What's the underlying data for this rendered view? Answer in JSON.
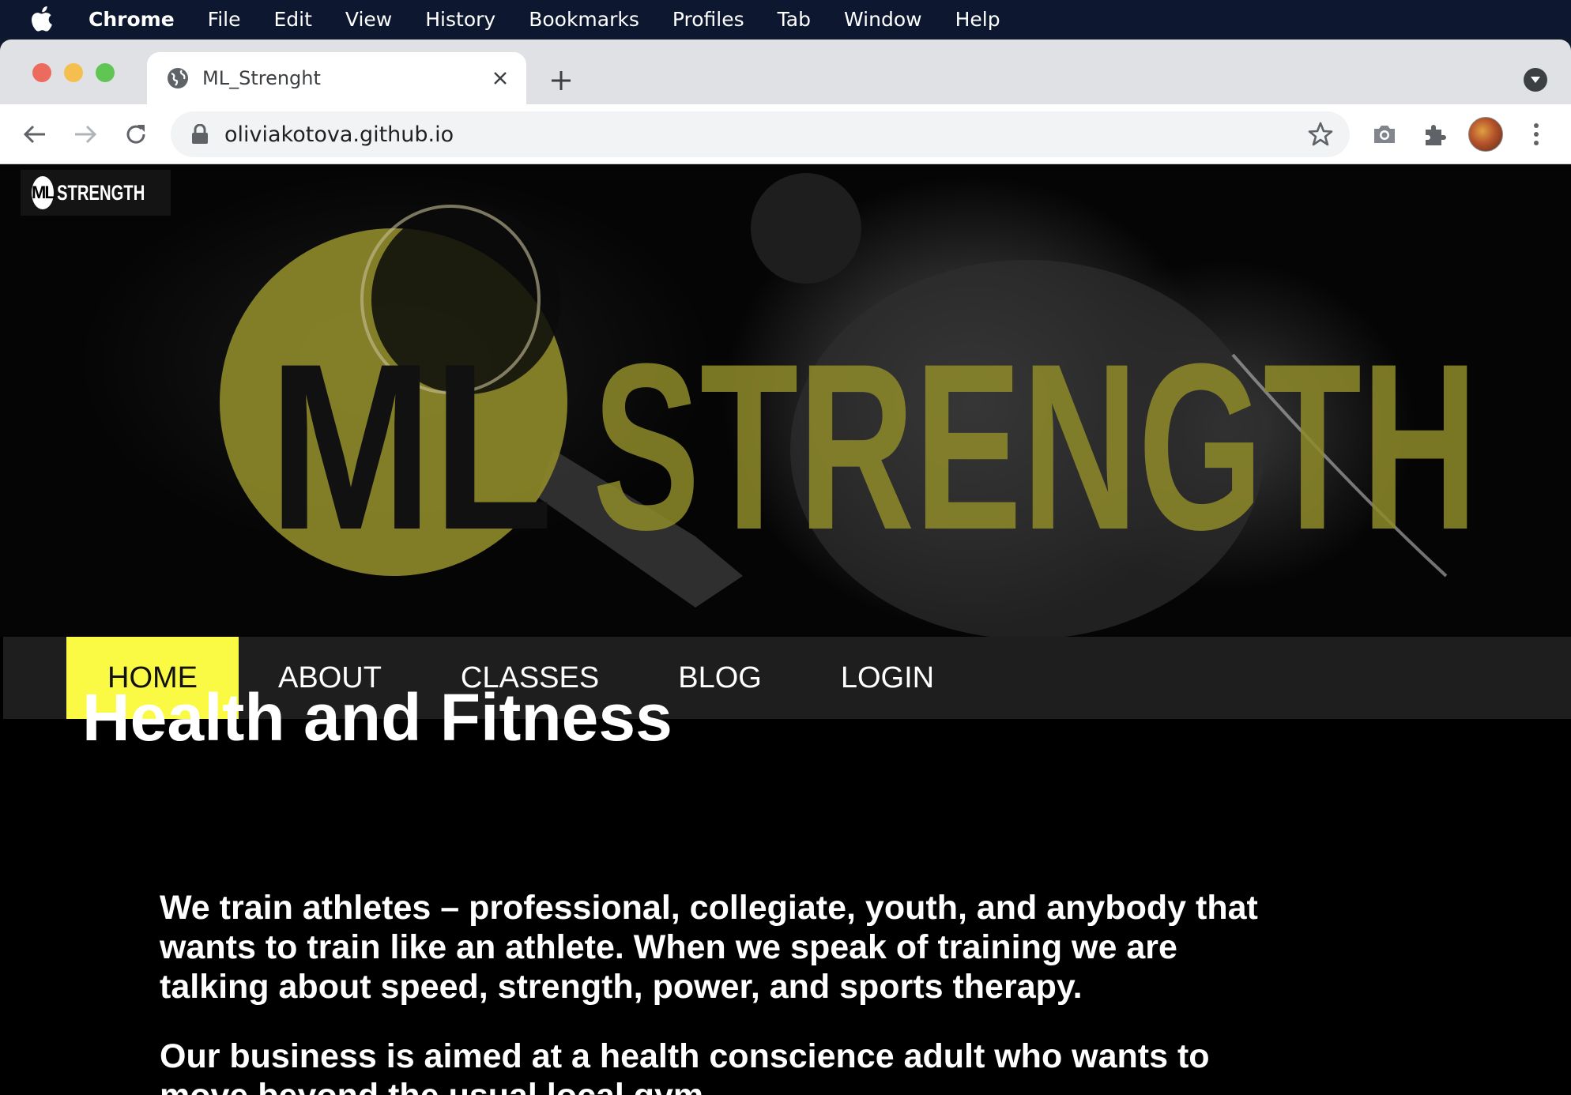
{
  "menubar": {
    "app": "Chrome",
    "items": [
      "File",
      "Edit",
      "View",
      "History",
      "Bookmarks",
      "Profiles",
      "Tab",
      "Window",
      "Help"
    ]
  },
  "tab": {
    "title": "ML_Strenght"
  },
  "toolbar": {
    "url": "oliviakotova.github.io"
  },
  "site": {
    "small_logo_mark": "ML",
    "small_logo_word": "STRENGTH",
    "hero_logo_mark": "ML",
    "hero_logo_word": "STRENGTH",
    "nav": [
      "HOME",
      "ABOUT",
      "CLASSES",
      "BLOG",
      "LOGIN"
    ],
    "active_nav": "HOME",
    "heading": "Health and Fitness",
    "paragraph1": "We train athletes – professional, collegiate, youth, and anybody that wants to train like an athlete. When we speak of training we are talking about speed, strength, power, and sports therapy.",
    "paragraph2": "Our business is aimed at a health conscience adult who wants to move beyond the usual local gym."
  },
  "colors": {
    "accent_yellow": "#fafa44",
    "logo_olive": "#8f8b2a",
    "menubar_bg": "#0d1830"
  }
}
